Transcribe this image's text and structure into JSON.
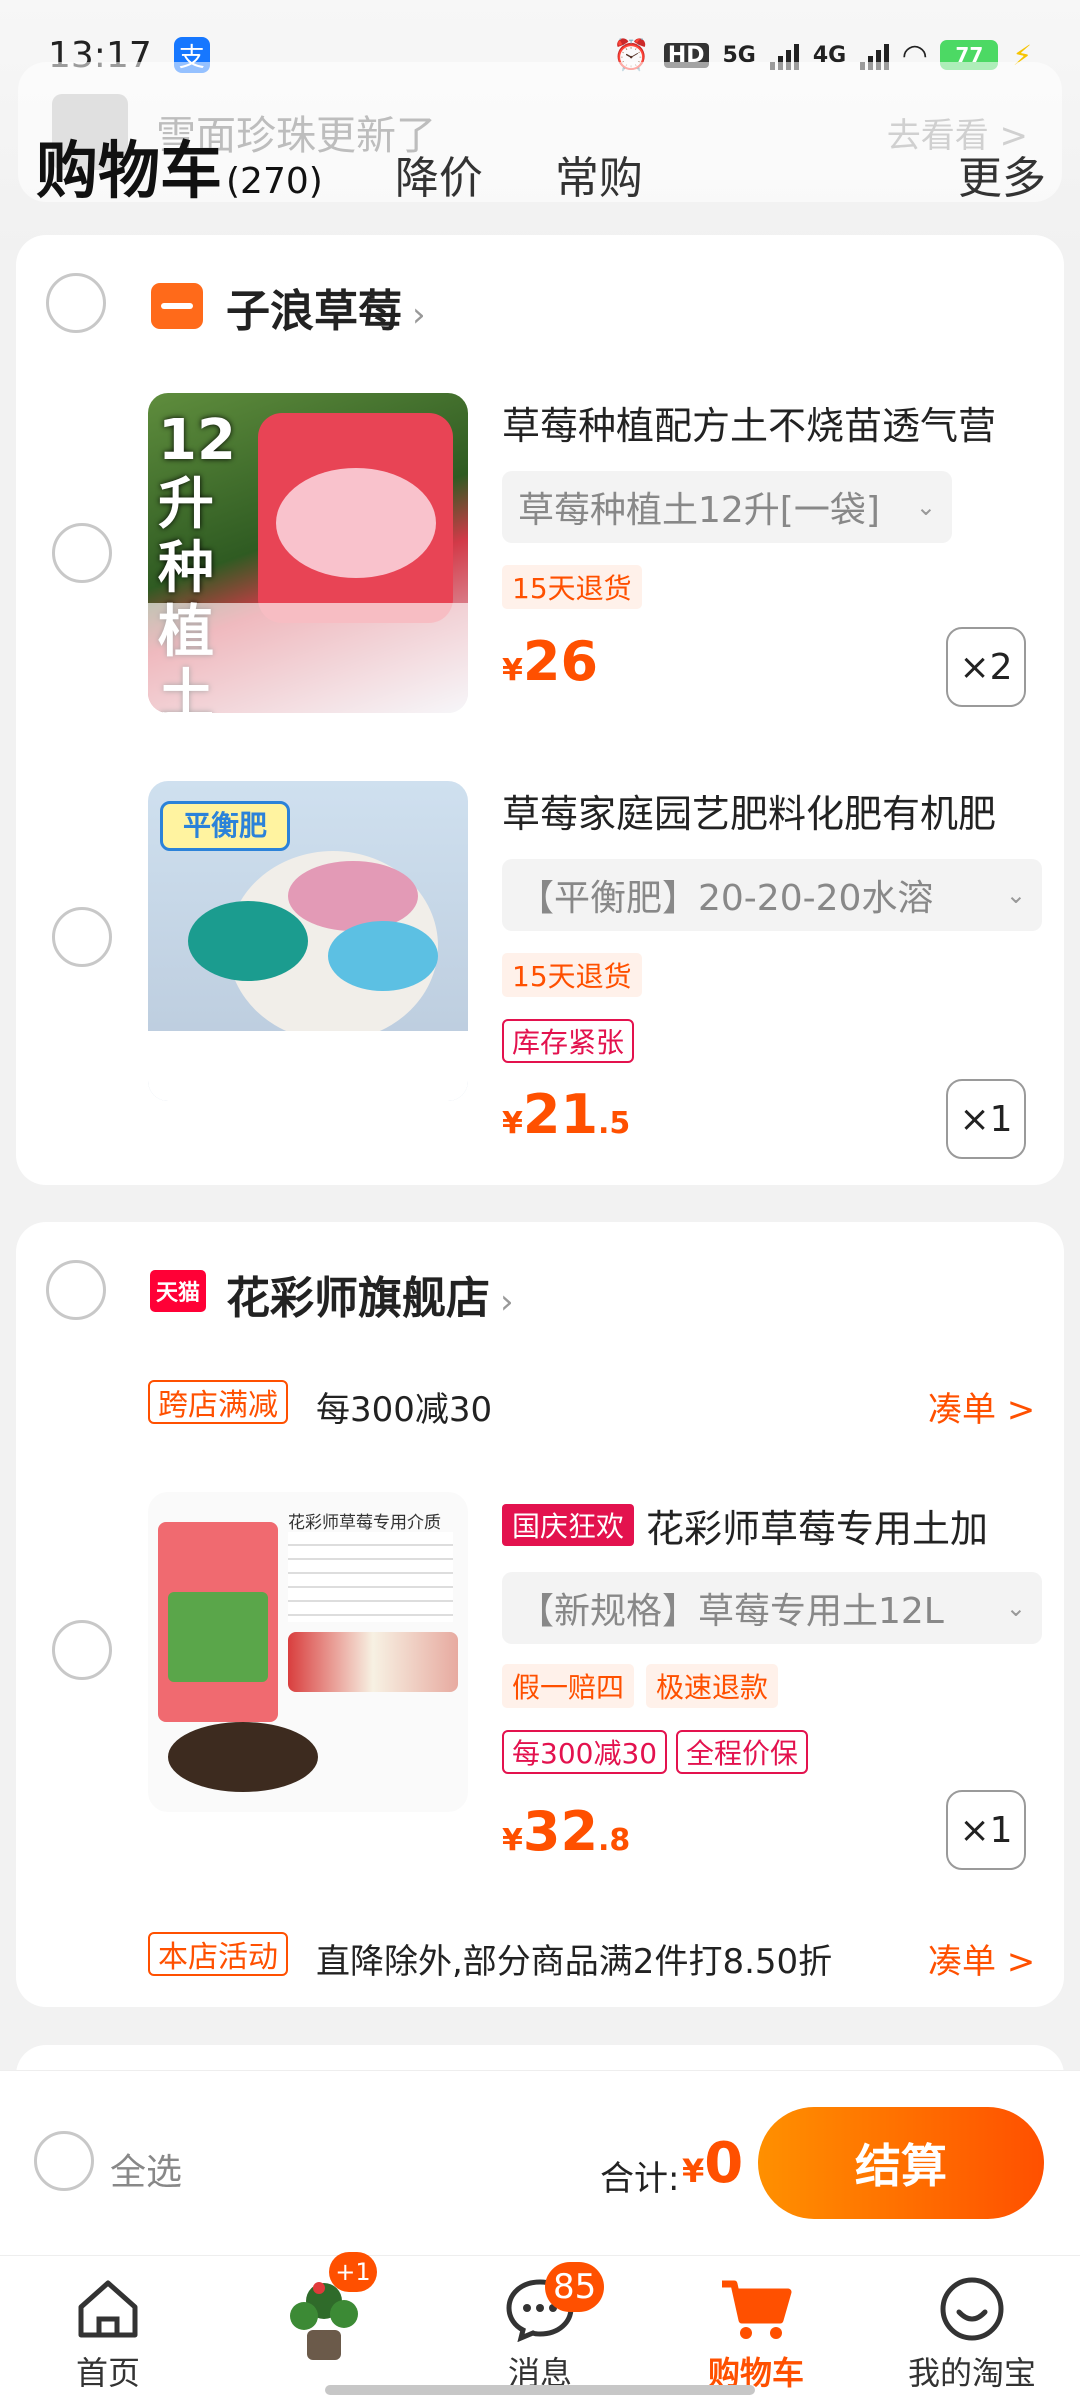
{
  "status_bar": {
    "time": "13:17",
    "alipay_glyph": "支",
    "hd": "HD",
    "net1": "5G",
    "net2": "4G",
    "battery": "77"
  },
  "notice": {
    "text": "雪面珍珠更新了",
    "action": "去看看 >"
  },
  "header": {
    "title": "购物车",
    "count": "(270)",
    "tabs": [
      "降价",
      "常购"
    ],
    "more": "更多"
  },
  "shop1": {
    "name": "子浪草莓",
    "products": [
      {
        "title": "草莓种植配方土不烧苗透气营",
        "sku": "草莓种植土12升[一袋]",
        "tags": [
          "15天退货"
        ],
        "warn_tag": "",
        "price_int": "26",
        "price_dec": "",
        "qty": "×2",
        "img_text": "12升种植土"
      },
      {
        "title": "草莓家庭园艺肥料化肥有机肥",
        "sku": "【平衡肥】20-20-20水溶",
        "tags": [
          "15天退货"
        ],
        "warn_tag": "库存紧张",
        "price_int": "21",
        "price_dec": ".5",
        "qty": "×1",
        "img_text": "平衡肥"
      }
    ]
  },
  "shop2": {
    "name": "花彩师旗舰店",
    "tmall_label": "天猫",
    "promo_tag": "跨店满减",
    "promo_text": "每300减30",
    "promo_action": "凑单 >",
    "product": {
      "badge": "国庆狂欢",
      "title": "花彩师草莓专用土加",
      "sku": "【新规格】草莓专用土12L",
      "tags": [
        "假一赔四",
        "极速退款"
      ],
      "red_tags": [
        "每300减30",
        "全程价保"
      ],
      "price_int": "32",
      "price_dec": ".8",
      "qty": "×1",
      "img_text": "花彩师草莓专用介质"
    },
    "store_tag": "本店活动",
    "store_text": "直降除外,部分商品满2件打8.50折",
    "store_action": "凑单 >"
  },
  "checkout": {
    "select_all": "全选",
    "total_label": "合计:",
    "currency": "¥",
    "total": "0",
    "button": "结算"
  },
  "tabbar": {
    "items": [
      {
        "label": "首页",
        "icon": "home-icon"
      },
      {
        "label": "",
        "icon": "plant-thumbnail",
        "badge": "+1"
      },
      {
        "label": "消息",
        "icon": "message-icon",
        "badge": "85"
      },
      {
        "label": "购物车",
        "icon": "cart-icon"
      },
      {
        "label": "我的淘宝",
        "icon": "smile-icon"
      }
    ]
  },
  "colors": {
    "accent": "#ff5000",
    "tmall": "#ff0036",
    "tag_red": "#e3124e"
  }
}
